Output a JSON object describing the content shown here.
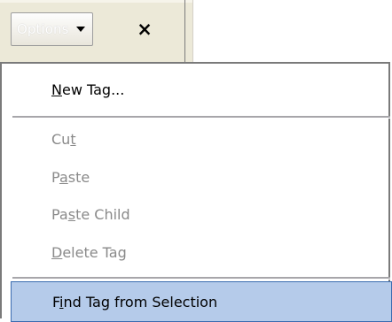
{
  "toolbar": {
    "options_label": "Options",
    "close_glyph": "×"
  },
  "menu": {
    "new_tag": {
      "pre": "",
      "mnemonic": "N",
      "post": "ew Tag..."
    },
    "cut": {
      "pre": "Cu",
      "mnemonic": "t",
      "post": ""
    },
    "paste": {
      "pre": "P",
      "mnemonic": "a",
      "post": "ste"
    },
    "paste_child": {
      "pre": "Pa",
      "mnemonic": "s",
      "post": "te Child"
    },
    "delete_tag": {
      "pre": "",
      "mnemonic": "D",
      "post": "elete Tag"
    },
    "find_tag": {
      "pre": "F",
      "mnemonic": "i",
      "post": "nd Tag from Selection"
    }
  },
  "colors": {
    "selection_bg": "#b5cbea",
    "selection_border": "#3b6cb0",
    "disabled_text": "#8a8a8a",
    "toolbar_bg": "#ece9d8"
  },
  "icons": {
    "dropdown": "caret-down-icon",
    "close": "close-icon"
  }
}
